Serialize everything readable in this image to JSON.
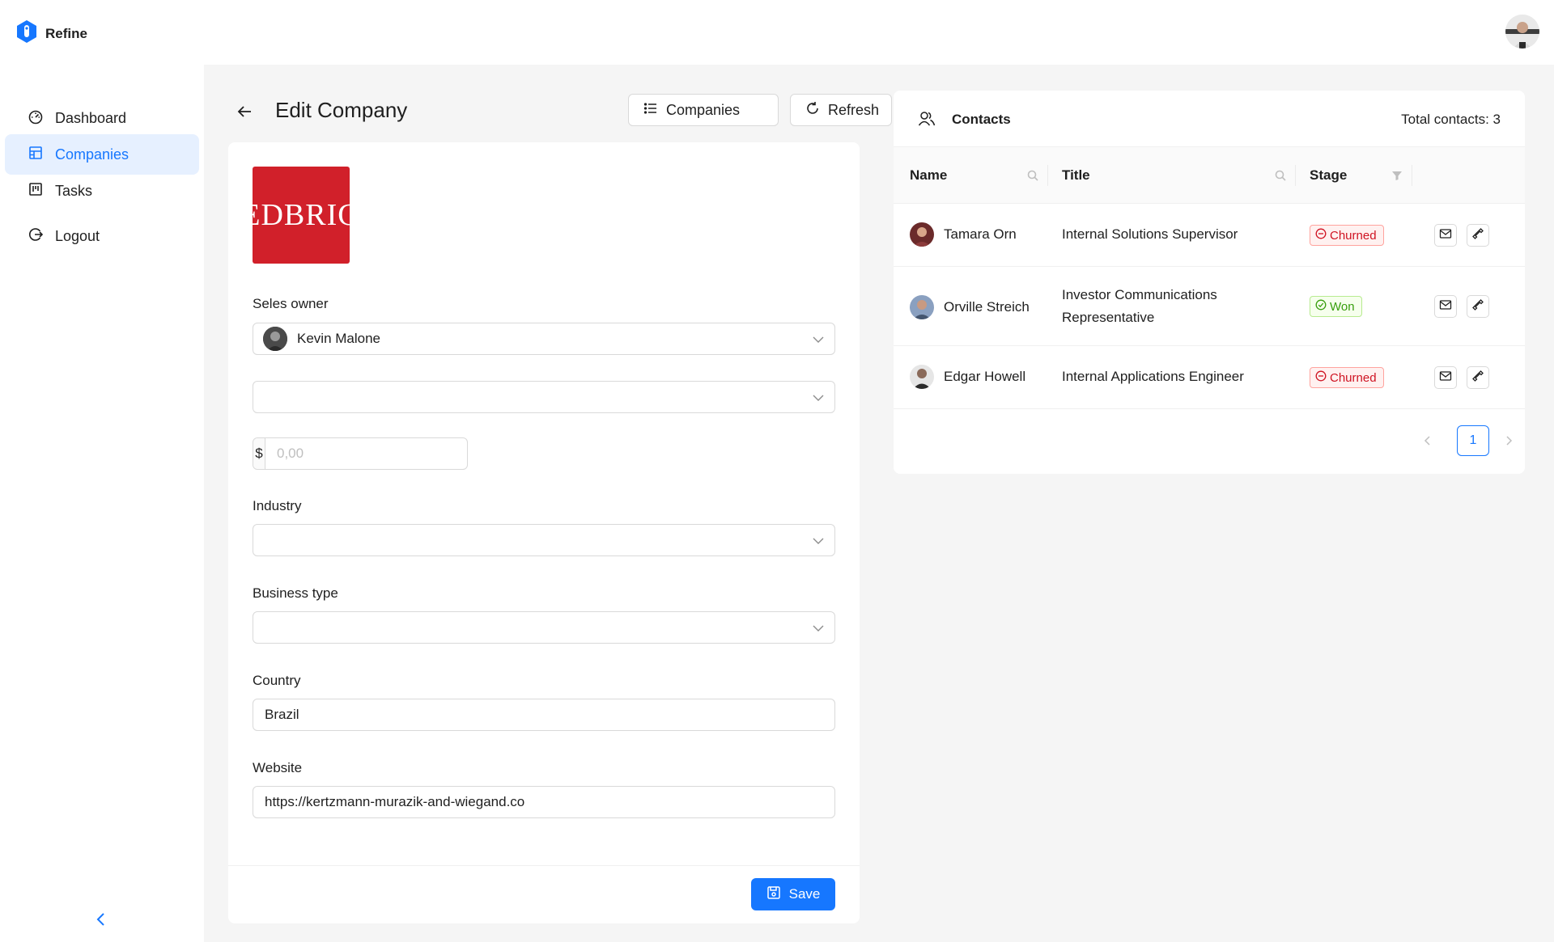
{
  "app": {
    "name": "Refine"
  },
  "sidebar": {
    "items": [
      {
        "label": "Dashboard",
        "icon": "dashboard-icon",
        "active": false
      },
      {
        "label": "Companies",
        "icon": "shop-icon",
        "active": true
      },
      {
        "label": "Tasks",
        "icon": "project-icon",
        "active": false
      },
      {
        "label": "Logout",
        "icon": "logout-icon",
        "active": false
      }
    ]
  },
  "page": {
    "title": "Edit Company",
    "companies_button": "Companies",
    "refresh_button": "Refresh"
  },
  "form": {
    "logo_text": "EDBRIG",
    "sales_owner_label": "Seles owner",
    "sales_owner_value": "Kevin Malone",
    "company_size_value": "",
    "revenue_prefix": "$",
    "revenue_placeholder": "0,00",
    "industry_label": "Industry",
    "industry_value": "",
    "business_type_label": "Business type",
    "business_type_value": "",
    "country_label": "Country",
    "country_value": "Brazil",
    "website_label": "Website",
    "website_value": "https://kertzmann-murazik-and-wiegand.co",
    "save_button": "Save"
  },
  "contacts": {
    "title": "Contacts",
    "total_label": "Total contacts: ",
    "total_count": "3",
    "columns": {
      "name": "Name",
      "title": "Title",
      "stage": "Stage"
    },
    "rows": [
      {
        "name": "Tamara Orn",
        "title": "Internal Solutions Supervisor",
        "stage": "Churned"
      },
      {
        "name": "Orville Streich",
        "title": "Investor Communications Representative",
        "stage": "Won"
      },
      {
        "name": "Edgar Howell",
        "title": "Internal Applications Engineer",
        "stage": "Churned"
      }
    ],
    "pagination": {
      "current_page": "1"
    }
  },
  "colors": {
    "primary": "#1677ff",
    "logo_background": "#d1202a",
    "churned": "#cf1322",
    "won": "#389e0d",
    "content_background": "#f5f5f5"
  }
}
